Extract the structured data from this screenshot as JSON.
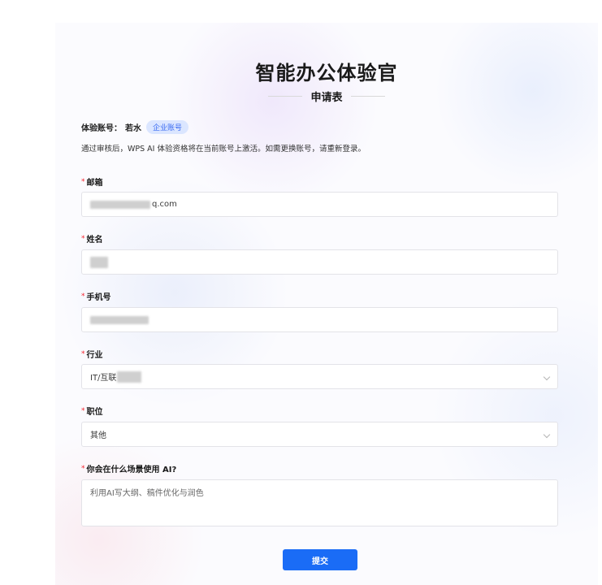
{
  "title": "智能办公体验官",
  "subtitle": "申请表",
  "account": {
    "label": "体验账号：",
    "name": "若水",
    "badge": "企业账号"
  },
  "notice": "通过审核后，WPS AI 体验资格将在当前账号上激活。如需更换账号，请重新登录。",
  "required_mark": "*",
  "fields": {
    "email": {
      "label": "邮箱",
      "value": "q.com"
    },
    "name": {
      "label": "姓名",
      "value": ""
    },
    "phone": {
      "label": "手机号",
      "value": ""
    },
    "industry": {
      "label": "行业",
      "value": "IT/互联"
    },
    "position": {
      "label": "职位",
      "value": "其他"
    },
    "usage": {
      "label": "你会在什么场景使用 AI?",
      "placeholder": "利用AI写大纲、稿件优化与润色"
    }
  },
  "submit_label": "提交",
  "colors": {
    "accent": "#1a6cf6",
    "badge_bg": "#dbe6ff",
    "required": "#f5222d"
  },
  "icons": {
    "select_arrow": "chevron-down-icon"
  }
}
